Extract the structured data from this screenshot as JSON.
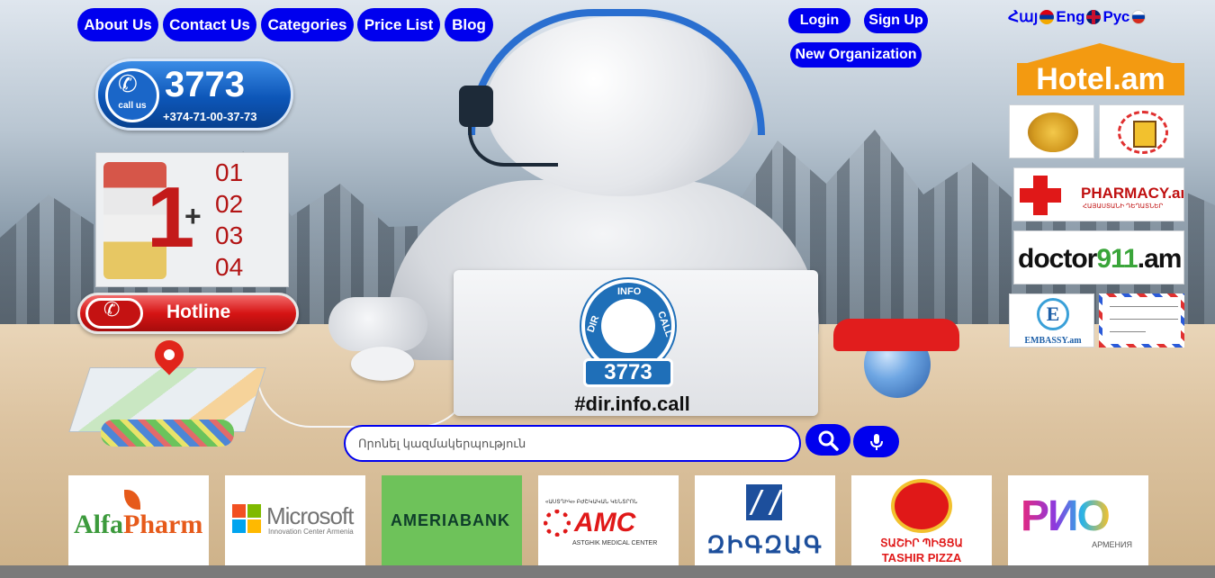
{
  "nav": {
    "about": "About Us",
    "contact": "Contact Us",
    "categories": "Categories",
    "price_list": "Price List",
    "blog": "Blog"
  },
  "auth": {
    "login": "Login",
    "signup": "Sign Up",
    "new_org": "New Organization"
  },
  "languages": [
    {
      "label": "Հայ",
      "flag": "armenia-flag-icon"
    },
    {
      "label": "Eng",
      "flag": "uk-flag-icon"
    },
    {
      "label": "Рус",
      "flag": "russia-flag-icon"
    }
  ],
  "left": {
    "callus_label": "call us",
    "callus_number": "3773",
    "callus_phone": "+374-71-00-37-73",
    "emergency_main": "1",
    "emergency_plus": "+",
    "emergency_codes": [
      "01",
      "02",
      "03",
      "04"
    ],
    "hotline_label": "Hotline"
  },
  "center": {
    "logo_top": "INFO",
    "logo_left": "DIR",
    "logo_right": "CALL",
    "logo_number": "3773",
    "hashtag": "#dir.info.call"
  },
  "right": {
    "hotel": "Hotel.am",
    "pharmacy": "PHARMACY.am",
    "pharmacy_sub": "ՀԱՅԱՍՏԱՆԻ ԴԵՂԱՏՆԵՐ",
    "doctor_a": "doctor",
    "doctor_b": "911",
    "doctor_c": ".am",
    "embassy_letter": "E",
    "embassy": "EMBASSY.am"
  },
  "search": {
    "placeholder": "Որոնել կազմակերպություն"
  },
  "partners": {
    "alfa_a": "Alfa",
    "alfa_b": "Pharm",
    "ms": "Microsoft",
    "ms_sub": "Innovation Center Armenia",
    "ameria": "AMERIABANK",
    "amc_top": "«ԱՍՏՂԻԿ» ԲԺՇԿԱԿԱՆ ԿԵՆՏՐՈՆ",
    "amc": "AMC",
    "amc_sub": "ASTGHIK MEDICAL CENTER",
    "zig": "ԶԻԳԶԱԳ",
    "tash_arm": "ՏԱՇԻՐ ՊԻՑՑԱ",
    "tash_en": "TASHIR PIZZA",
    "rio": "РИО",
    "rio_sub": "АРМЕНИЯ"
  },
  "colors": {
    "primary": "#0000ee",
    "hotline": "#d61414",
    "hotel": "#f39a11"
  }
}
